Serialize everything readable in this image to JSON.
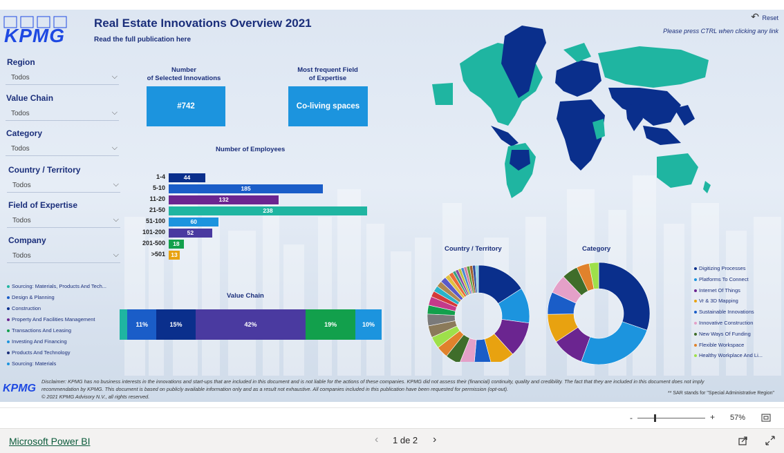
{
  "header": {
    "logo": "KPMG",
    "title": "Real Estate Innovations Overview 2021",
    "subtitle_link": "Read the full publication here",
    "reset_label": "Reset",
    "reset_note": "Please press CTRL when clicking any link"
  },
  "filters": [
    {
      "label": "Region",
      "value": "Todos"
    },
    {
      "label": "Value Chain",
      "value": "Todos"
    },
    {
      "label": "Category",
      "value": "Todos"
    },
    {
      "label": "Country / Territory",
      "value": "Todos"
    },
    {
      "label": "Field of Expertise",
      "value": "Todos"
    },
    {
      "label": "Company",
      "value": "Todos"
    }
  ],
  "kpis": [
    {
      "label_line1": "Number",
      "label_line2": "of Selected Innovations",
      "value": "#742"
    },
    {
      "label_line1": "Most frequent Field",
      "label_line2": "of Expertise",
      "value": "Co-living spaces"
    }
  ],
  "colors": {
    "navy": "#0a2f8c",
    "blue": "#1c94de",
    "royal": "#1a5dc8",
    "purple": "#6b2590",
    "teal": "#1fb5a1",
    "indigo": "#4a3aa0",
    "green": "#12a04c",
    "orange": "#e8a210",
    "pink": "#e4a0c8",
    "darkgreen": "#3f6d2a",
    "amber": "#e0822c",
    "lime": "#9ee04a"
  },
  "chart_data": [
    {
      "type": "bar",
      "title": "Number of Employees",
      "categories": [
        "1-4",
        "5-10",
        "11-20",
        "21-50",
        "51-100",
        "101-200",
        "201-500",
        ">501"
      ],
      "values": [
        44,
        185,
        132,
        238,
        60,
        52,
        18,
        13
      ],
      "colors": [
        "#0a2f8c",
        "#1a5dc8",
        "#6b2590",
        "#1fb5a1",
        "#1c94de",
        "#4a3aa0",
        "#12a04c",
        "#e8a210"
      ]
    },
    {
      "type": "bar",
      "title": "Value Chain",
      "orientation": "stacked-horizontal",
      "series": [
        {
          "name": "Sourcing: Materials, Products And Tech...",
          "value": 3,
          "label": "",
          "color": "#1fb5a1"
        },
        {
          "name": "Design & Planning",
          "value": 11,
          "label": "11%",
          "color": "#1a5dc8"
        },
        {
          "name": "Construction",
          "value": 15,
          "label": "15%",
          "color": "#0a2f8c"
        },
        {
          "name": "Property And Facilities Management",
          "value": 42,
          "label": "42%",
          "color": "#4a3aa0"
        },
        {
          "name": "Transactions And Leasing",
          "value": 19,
          "label": "19%",
          "color": "#12a04c"
        },
        {
          "name": "Investing And Financing",
          "value": 10,
          "label": "10%",
          "color": "#1c94de"
        }
      ],
      "legend": [
        {
          "name": "Sourcing: Materials, Products And Tech...",
          "color": "#1fb5a1"
        },
        {
          "name": "Design & Planning",
          "color": "#1a5dc8"
        },
        {
          "name": "Construction",
          "color": "#0a2f8c"
        },
        {
          "name": "Property And Facilities Management",
          "color": "#6b2590"
        },
        {
          "name": "Transactions And Leasing",
          "color": "#12a04c"
        },
        {
          "name": "Investing And Financing",
          "color": "#1c94de"
        },
        {
          "name": "Products And Technology",
          "color": "#1a2e7a"
        },
        {
          "name": "Sourcing: Materials",
          "color": "#1c94de"
        }
      ]
    },
    {
      "type": "pie",
      "title": "Country / Territory",
      "values": [
        17,
        12,
        12,
        8,
        6,
        5,
        5,
        4,
        4,
        4,
        4,
        3,
        3,
        2,
        2,
        2,
        2,
        1.5,
        1.5,
        1,
        1,
        1,
        1,
        1,
        1,
        1,
        1,
        1
      ],
      "colors": [
        "#0a2f8c",
        "#1c94de",
        "#6b2590",
        "#e8a210",
        "#1a5dc8",
        "#e4a0c8",
        "#3f6d2a",
        "#e0822c",
        "#9ee04a",
        "#8b7a5a",
        "#7a7a7a",
        "#12a04c",
        "#c43a8a",
        "#d43a3a",
        "#2ab3c8",
        "#b08850",
        "#5a5ac8",
        "#e0c040",
        "#ea6a3a",
        "#3aa080",
        "#8a4aa0",
        "#c0c040",
        "#4a8ad0",
        "#d080a0",
        "#60a040",
        "#a06030",
        "#3050a0",
        "#90d0e0"
      ]
    },
    {
      "type": "pie",
      "title": "Category",
      "series": [
        {
          "name": "Digitizing Processes",
          "value": 30,
          "color": "#0a2f8c"
        },
        {
          "name": "Platforms To Connect",
          "value": 25,
          "color": "#1c94de"
        },
        {
          "name": "Internet Of Things",
          "value": 10,
          "color": "#6b2590"
        },
        {
          "name": "Vr & 3D Mapping",
          "value": 9,
          "color": "#e8a210"
        },
        {
          "name": "Sustainable Innovations",
          "value": 7,
          "color": "#1a5dc8"
        },
        {
          "name": "Innovative Construction",
          "value": 6,
          "color": "#e4a0c8"
        },
        {
          "name": "New Ways Of Funding",
          "value": 5,
          "color": "#3f6d2a"
        },
        {
          "name": "Flexible Workspace",
          "value": 4,
          "color": "#e0822c"
        },
        {
          "name": "Healthy Workplace And Li...",
          "value": 3,
          "color": "#9ee04a"
        }
      ]
    }
  ],
  "footer_note": {
    "disclaimer_1": "Disclaimer: KPMG has no business interests in the innovations and start-ups that are included in this document and is not liable for the actions of these companies. KPMG did not assess their (financial) continuity, quality and credibility. The fact that they are included in this document does not imply",
    "disclaimer_2": "recommendation by KPMG. This document is based on publicly available information only and as a result not exhaustive. All companies included in this publication have been requested for permission (opt-out).",
    "copyright": "© 2021 KPMG Advisory N.V., all rights reserved.",
    "sar": "** SAR stands for \"Special Administrative Region\"",
    "logo": "KPMG"
  },
  "viewer": {
    "zoom": "57%",
    "zoom_minus": "-",
    "zoom_plus": "+",
    "brand": "Microsoft Power BI",
    "page_indicator": "1 de 2",
    "prev_icon": "‹",
    "next_icon": "›"
  }
}
